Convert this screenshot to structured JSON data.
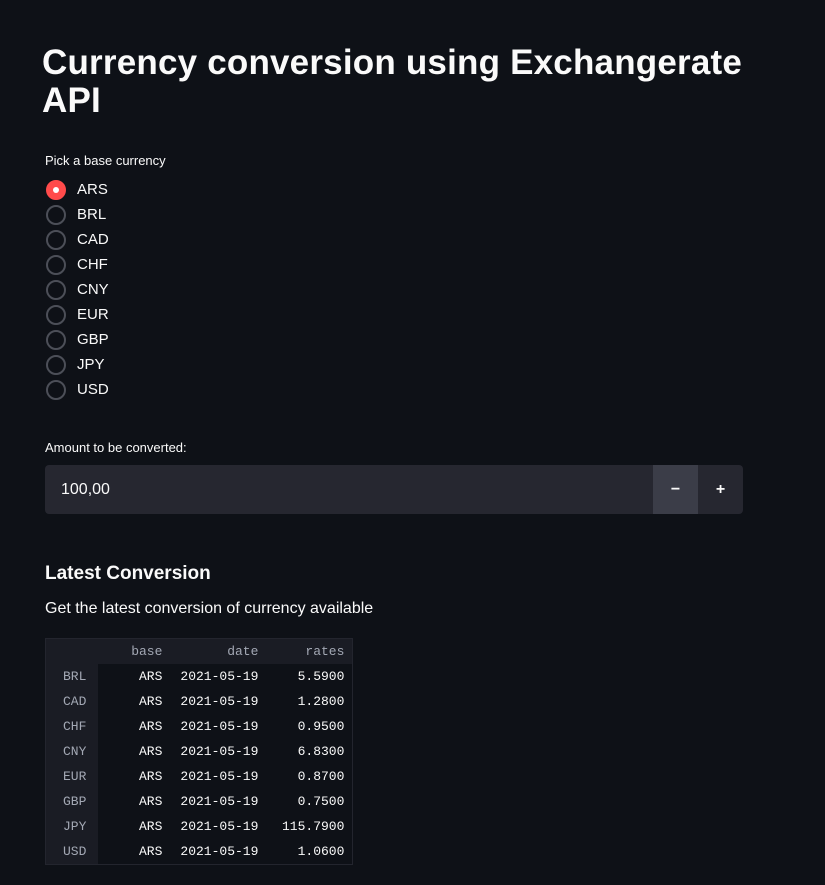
{
  "title": "Currency conversion using Exchangerate API",
  "radio": {
    "label": "Pick a base currency",
    "selected": "ARS",
    "options": [
      "ARS",
      "BRL",
      "CAD",
      "CHF",
      "CNY",
      "EUR",
      "GBP",
      "JPY",
      "USD"
    ]
  },
  "amount": {
    "label": "Amount to be converted:",
    "value": "100,00",
    "minus_label": "−",
    "plus_label": "+"
  },
  "section": {
    "header": "Latest Conversion",
    "description": "Get the latest conversion of currency available"
  },
  "table": {
    "columns": [
      "",
      "base",
      "date",
      "rates"
    ],
    "rows": [
      {
        "index": "BRL",
        "base": "ARS",
        "date": "2021-05-19",
        "rates": "5.5900"
      },
      {
        "index": "CAD",
        "base": "ARS",
        "date": "2021-05-19",
        "rates": "1.2800"
      },
      {
        "index": "CHF",
        "base": "ARS",
        "date": "2021-05-19",
        "rates": "0.9500"
      },
      {
        "index": "CNY",
        "base": "ARS",
        "date": "2021-05-19",
        "rates": "6.8300"
      },
      {
        "index": "EUR",
        "base": "ARS",
        "date": "2021-05-19",
        "rates": "0.8700"
      },
      {
        "index": "GBP",
        "base": "ARS",
        "date": "2021-05-19",
        "rates": "0.7500"
      },
      {
        "index": "JPY",
        "base": "ARS",
        "date": "2021-05-19",
        "rates": "115.7900"
      },
      {
        "index": "USD",
        "base": "ARS",
        "date": "2021-05-19",
        "rates": "1.0600"
      }
    ]
  },
  "colors": {
    "background": "#0e1117",
    "accent": "#ff4b4b",
    "input_bg": "#262730",
    "table_header_bg": "#1a1c24"
  }
}
